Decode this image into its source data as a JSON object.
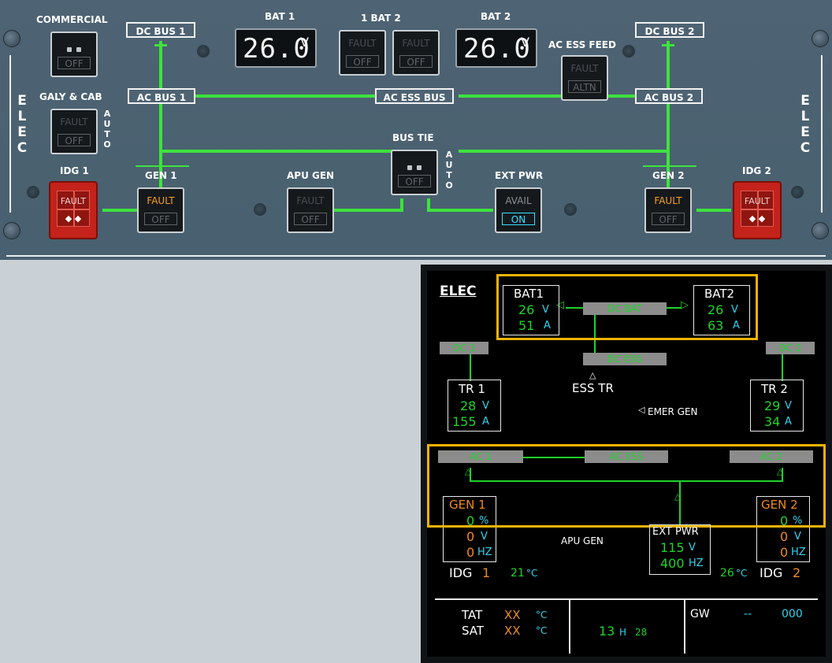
{
  "overhead": {
    "side_label_left": "E\nL\nE\nC",
    "side_label_right": "E\nL\nE\nC",
    "commercial": {
      "label": "COMMERCIAL",
      "bottom": "OFF"
    },
    "galy_cab": {
      "label": "GALY & CAB",
      "top": "FAULT",
      "bottom": "OFF",
      "auto": "A\nU\nT\nO"
    },
    "idg1": {
      "label": "IDG 1",
      "fault": "FAULT",
      "dots": "◆ ◆"
    },
    "idg2": {
      "label": "IDG 2",
      "fault": "FAULT",
      "dots": "◆ ◆"
    },
    "gen1": {
      "label": "GEN 1",
      "top": "FAULT",
      "bottom": "OFF"
    },
    "gen2": {
      "label": "GEN 2",
      "top": "FAULT",
      "bottom": "OFF"
    },
    "apu_gen": {
      "label": "APU GEN",
      "top": "FAULT",
      "bottom": "OFF"
    },
    "bus_tie": {
      "label": "BUS TIE",
      "bottom": "OFF",
      "auto": "A\nU\nT\nO"
    },
    "ext_pwr": {
      "label": "EXT PWR",
      "top": "AVAIL",
      "bottom": "ON"
    },
    "bat1": {
      "label": "BAT 1",
      "value": "26.0",
      "unit": "V"
    },
    "bat2": {
      "label": "BAT 2",
      "value": "26.0",
      "unit": "V"
    },
    "bat_switches": {
      "label": "1  BAT  2",
      "top": "FAULT",
      "bottom": "OFF"
    },
    "ac_ess_feed": {
      "label": "AC ESS FEED",
      "top": "FAULT",
      "bottom": "ALTN"
    },
    "buses": {
      "dc_bus_1": "DC BUS 1",
      "dc_bus_2": "DC BUS 2",
      "ac_bus_1": "AC BUS 1",
      "ac_bus_2": "AC BUS 2",
      "ac_ess_bus": "AC ESS BUS"
    }
  },
  "ecam": {
    "title": "ELEC",
    "bat1": {
      "label": "BAT1",
      "volts": "26",
      "v_unit": "V",
      "amps": "51",
      "a_unit": "A"
    },
    "bat2": {
      "label": "BAT2",
      "volts": "26",
      "v_unit": "V",
      "amps": "63",
      "a_unit": "A"
    },
    "bars": {
      "dc_bat": "DC BAT",
      "dc1": "DC 1",
      "dc2": "DC 2",
      "dc_ess": "DC ESS",
      "ac1": "AC 1",
      "ac_ess": "AC ESS",
      "ac2": "AC 2"
    },
    "ess_tr": "ESS TR",
    "emer_gen": "EMER GEN",
    "tr1": {
      "label": "TR 1",
      "volts": "28",
      "v_unit": "V",
      "amps": "155",
      "a_unit": "A"
    },
    "tr2": {
      "label": "TR 2",
      "volts": "29",
      "v_unit": "V",
      "amps": "34",
      "a_unit": "A"
    },
    "gen1": {
      "label": "GEN 1",
      "load": "0",
      "load_unit": "%",
      "volts": "0",
      "v_unit": "V",
      "hz": "0",
      "hz_unit": "HZ"
    },
    "gen2": {
      "label": "GEN 2",
      "load": "0",
      "load_unit": "%",
      "volts": "0",
      "v_unit": "V",
      "hz": "0",
      "hz_unit": "HZ"
    },
    "apu_gen": "APU GEN",
    "ext_pwr": {
      "label": "EXT PWR",
      "volts": "115",
      "v_unit": "V",
      "hz": "400",
      "hz_unit": "HZ"
    },
    "idg1": {
      "label": "IDG",
      "num": "1",
      "temp": "21",
      "temp_unit": "°C"
    },
    "idg2": {
      "label": "IDG",
      "num": "2",
      "temp": "26",
      "temp_unit": "°C"
    },
    "footer": {
      "tat_label": "TAT",
      "tat_value": "XX",
      "tat_unit": "°C",
      "sat_label": "SAT",
      "sat_value": "XX",
      "sat_unit": "°C",
      "time_h": "13",
      "time_h_unit": "H",
      "time_m": "28",
      "gw_label": "GW",
      "gw_dashes": "--",
      "gw_value": "000"
    }
  }
}
